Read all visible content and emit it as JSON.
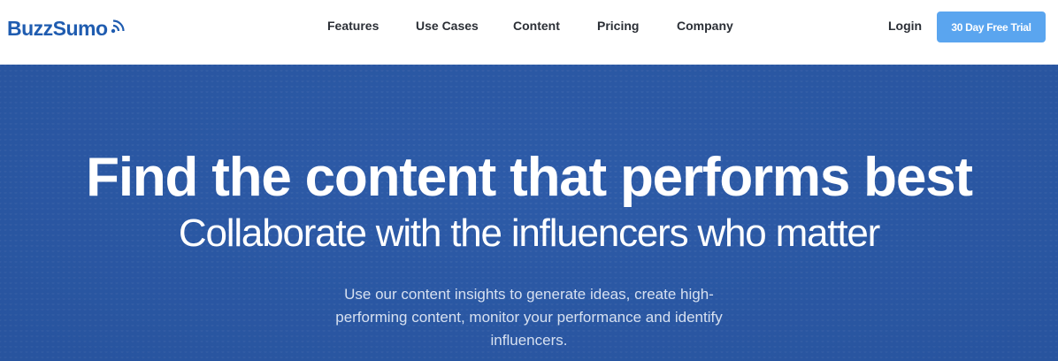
{
  "brand": {
    "name": "BuzzSumo",
    "logo_color": "#1f5cb0"
  },
  "nav": {
    "items": [
      {
        "label": "Features"
      },
      {
        "label": "Use Cases"
      },
      {
        "label": "Content"
      },
      {
        "label": "Pricing"
      },
      {
        "label": "Company"
      }
    ],
    "login_label": "Login",
    "trial_label": "30 Day Free Trial",
    "trial_color": "#5aa5ef"
  },
  "hero": {
    "title": "Find the content that performs best",
    "subtitle": "Collaborate with the influencers who matter",
    "description": "Use our content insights to generate ideas, create high-performing content, monitor your performance and identify influencers.",
    "background_color": "#2d5ba8"
  }
}
